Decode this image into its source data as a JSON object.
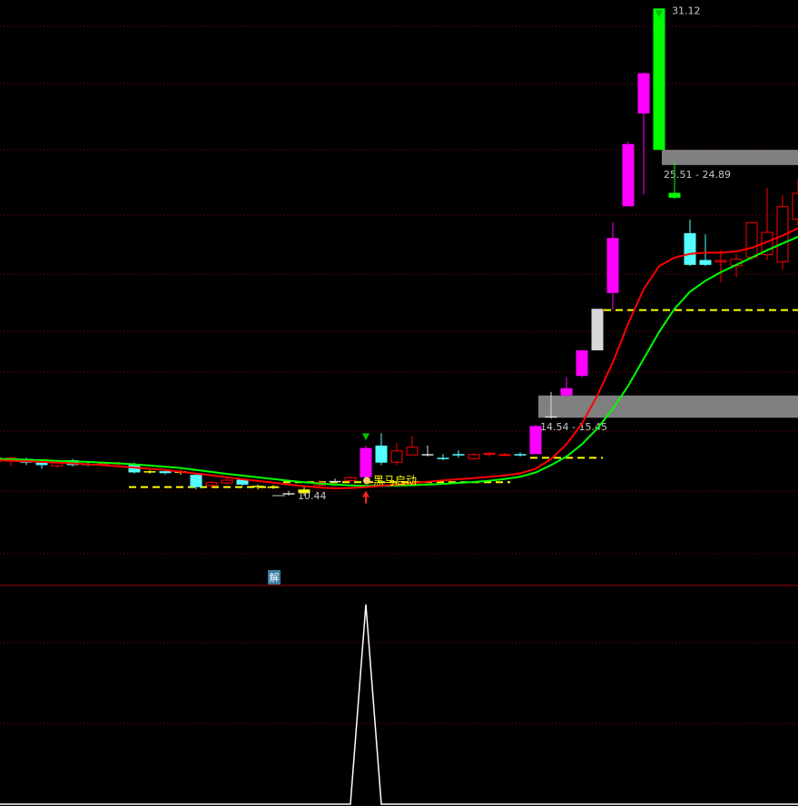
{
  "chart_data": {
    "type": "candlestick",
    "y_unit": "price",
    "ylim": [
      8.6,
      31.5
    ],
    "candles": [
      {
        "o": 12.9,
        "h": 13.0,
        "l": 12.7,
        "c": 12.75,
        "color": "white"
      },
      {
        "o": 12.75,
        "h": 12.95,
        "l": 12.55,
        "c": 12.9,
        "color": "red"
      },
      {
        "o": 12.85,
        "h": 12.9,
        "l": 12.6,
        "c": 12.7,
        "color": "cyan"
      },
      {
        "o": 12.7,
        "h": 12.8,
        "l": 12.45,
        "c": 12.6,
        "color": "cyan"
      },
      {
        "o": 12.55,
        "h": 12.8,
        "l": 12.5,
        "c": 12.75,
        "color": "red"
      },
      {
        "o": 12.8,
        "h": 12.85,
        "l": 12.55,
        "c": 12.6,
        "color": "cyan"
      },
      {
        "o": 12.65,
        "h": 12.72,
        "l": 12.55,
        "c": 12.62,
        "color": "cyan"
      },
      {
        "o": 12.6,
        "h": 12.75,
        "l": 12.55,
        "c": 12.68,
        "color": "red"
      },
      {
        "o": 12.65,
        "h": 12.75,
        "l": 12.5,
        "c": 12.7,
        "color": "red"
      },
      {
        "o": 12.65,
        "h": 12.7,
        "l": 12.25,
        "c": 12.3,
        "color": "cyan"
      },
      {
        "o": 12.35,
        "h": 12.4,
        "l": 12.25,
        "c": 12.3,
        "color": "yellow"
      },
      {
        "o": 12.35,
        "h": 12.42,
        "l": 12.22,
        "c": 12.27,
        "color": "cyan"
      },
      {
        "o": 12.35,
        "h": 12.4,
        "l": 12.2,
        "c": 12.28,
        "color": "yellow"
      },
      {
        "o": 12.2,
        "h": 12.25,
        "l": 11.6,
        "c": 11.7,
        "color": "cyan"
      },
      {
        "o": 11.75,
        "h": 11.95,
        "l": 11.65,
        "c": 11.9,
        "color": "red"
      },
      {
        "o": 11.85,
        "h": 12.1,
        "l": 11.8,
        "c": 12.0,
        "color": "red"
      },
      {
        "o": 12.0,
        "h": 12.05,
        "l": 11.75,
        "c": 11.8,
        "color": "cyan"
      },
      {
        "o": 11.75,
        "h": 11.8,
        "l": 11.6,
        "c": 11.72,
        "color": "yellow"
      },
      {
        "o": 11.72,
        "h": 11.78,
        "l": 11.62,
        "c": 11.72,
        "color": "yellow"
      },
      {
        "o": 11.45,
        "h": 11.55,
        "l": 11.35,
        "c": 11.45,
        "color": "white"
      },
      {
        "o": 11.6,
        "h": 11.7,
        "l": 11.35,
        "c": 11.45,
        "color": "yellow"
      },
      {
        "o": 11.75,
        "h": 12.0,
        "l": 11.7,
        "c": 11.9,
        "color": "red"
      },
      {
        "o": 11.95,
        "h": 12.05,
        "l": 11.9,
        "c": 11.95,
        "color": "white"
      },
      {
        "o": 11.95,
        "h": 12.15,
        "l": 11.9,
        "c": 12.1,
        "color": "red"
      },
      {
        "o": 12.1,
        "h": 13.4,
        "l": 12.1,
        "c": 13.3,
        "color": "magenta"
      },
      {
        "o": 13.4,
        "h": 13.9,
        "l": 12.6,
        "c": 12.7,
        "color": "cyan"
      },
      {
        "o": 12.7,
        "h": 13.5,
        "l": 12.6,
        "c": 13.2,
        "color": "red"
      },
      {
        "o": 13.0,
        "h": 13.8,
        "l": 13.0,
        "c": 13.35,
        "color": "red"
      },
      {
        "o": 13.05,
        "h": 13.4,
        "l": 12.95,
        "c": 13.05,
        "color": "white"
      },
      {
        "o": 12.9,
        "h": 13.05,
        "l": 12.8,
        "c": 12.9,
        "color": "cyan"
      },
      {
        "o": 13.05,
        "h": 13.2,
        "l": 12.9,
        "c": 13.05,
        "color": "cyan"
      },
      {
        "o": 12.85,
        "h": 13.1,
        "l": 12.8,
        "c": 13.05,
        "color": "red"
      },
      {
        "o": 13.05,
        "h": 13.15,
        "l": 12.95,
        "c": 13.1,
        "color": "red"
      },
      {
        "o": 13.05,
        "h": 13.1,
        "l": 13.0,
        "c": 13.05,
        "color": "red"
      },
      {
        "o": 13.05,
        "h": 13.12,
        "l": 12.95,
        "c": 13.05,
        "color": "cyan"
      },
      {
        "o": 13.05,
        "h": 14.25,
        "l": 13.05,
        "c": 14.2,
        "color": "magenta"
      },
      {
        "o": 14.55,
        "h": 15.6,
        "l": 14.5,
        "c": 14.6,
        "color": "white"
      },
      {
        "o": 15.45,
        "h": 16.2,
        "l": 15.4,
        "c": 15.75,
        "color": "magenta"
      },
      {
        "o": 16.25,
        "h": 17.3,
        "l": 16.2,
        "c": 17.3,
        "color": "magenta"
      },
      {
        "o": 17.3,
        "h": 19.0,
        "l": 17.3,
        "c": 19.0,
        "color": "white"
      },
      {
        "o": 19.65,
        "h": 22.55,
        "l": 18.95,
        "c": 21.9,
        "color": "magenta"
      },
      {
        "o": 23.2,
        "h": 25.85,
        "l": 23.2,
        "c": 25.75,
        "color": "magenta"
      },
      {
        "o": 27.0,
        "h": 28.7,
        "l": 23.7,
        "c": 28.65,
        "color": "magenta"
      },
      {
        "o": 31.3,
        "h": 31.3,
        "l": 25.51,
        "c": 25.51,
        "color": "green"
      },
      {
        "o": 23.75,
        "h": 25.0,
        "l": 23.5,
        "c": 23.55,
        "color": "green"
      },
      {
        "o": 22.1,
        "h": 22.65,
        "l": 20.75,
        "c": 20.8,
        "color": "cyan"
      },
      {
        "o": 21.0,
        "h": 22.05,
        "l": 20.75,
        "c": 20.8,
        "color": "cyan"
      },
      {
        "o": 21.0,
        "h": 21.4,
        "l": 20.1,
        "c": 20.9,
        "color": "red"
      },
      {
        "o": 20.75,
        "h": 21.25,
        "l": 20.3,
        "c": 21.05,
        "color": "red"
      },
      {
        "o": 21.1,
        "h": 22.55,
        "l": 21.0,
        "c": 22.55,
        "color": "red"
      },
      {
        "o": 21.2,
        "h": 23.95,
        "l": 21.0,
        "c": 22.15,
        "color": "red"
      },
      {
        "o": 20.9,
        "h": 23.65,
        "l": 20.6,
        "c": 23.2,
        "color": "red"
      },
      {
        "o": 22.65,
        "h": 24.3,
        "l": 22.4,
        "c": 23.75,
        "color": "red"
      },
      {
        "o": 22.9,
        "h": 25.0,
        "l": 22.6,
        "c": 24.75,
        "color": "red"
      }
    ],
    "ma_fast": [
      12.8,
      12.78,
      12.76,
      12.73,
      12.7,
      12.67,
      12.63,
      12.6,
      12.55,
      12.5,
      12.45,
      12.4,
      12.33,
      12.25,
      12.18,
      12.1,
      12.02,
      11.95,
      11.88,
      11.8,
      11.73,
      11.68,
      11.65,
      11.66,
      11.7,
      11.75,
      11.8,
      11.86,
      11.92,
      11.97,
      12.02,
      12.07,
      12.12,
      12.18,
      12.26,
      12.45,
      12.85,
      13.45,
      14.3,
      15.45,
      16.8,
      18.4,
      19.8,
      20.75,
      21.1,
      21.25,
      21.3,
      21.3,
      21.35,
      21.5,
      21.75,
      22.0,
      22.3,
      22.6
    ],
    "ma_slow": [
      12.85,
      12.84,
      12.82,
      12.8,
      12.77,
      12.75,
      12.73,
      12.7,
      12.67,
      12.63,
      12.58,
      12.53,
      12.48,
      12.4,
      12.32,
      12.24,
      12.17,
      12.1,
      12.03,
      11.96,
      11.9,
      11.84,
      11.8,
      11.77,
      11.75,
      11.75,
      11.76,
      11.78,
      11.8,
      11.83,
      11.87,
      11.91,
      11.96,
      12.03,
      12.12,
      12.3,
      12.6,
      12.95,
      13.45,
      14.1,
      14.9,
      15.85,
      16.95,
      18.05,
      19.0,
      19.7,
      20.15,
      20.5,
      20.8,
      21.1,
      21.4,
      21.68,
      21.95,
      22.2
    ],
    "support_levels": [
      {
        "y": 11.7,
        "x_from": 9,
        "x_to": 18
      },
      {
        "y": 11.9,
        "x_from": 19,
        "x_to": 33
      },
      {
        "y": 12.9,
        "x_from": 35,
        "x_to": 39
      },
      {
        "y": 18.95,
        "x_from": 39,
        "x_to": 53
      }
    ],
    "zones": [
      {
        "low": 14.54,
        "high": 15.45,
        "label": "14.54 - 15.45",
        "start": 35
      },
      {
        "low": 24.89,
        "high": 25.51,
        "label": "25.51 - 24.89",
        "start": 43
      }
    ],
    "annotations": {
      "high_label": "31.12",
      "low_label": "10.44",
      "signal_text": "黑马启动",
      "badge": "解"
    },
    "indicator": {
      "type": "line",
      "values": [
        0,
        0,
        0,
        0,
        0,
        0,
        0,
        0,
        0,
        0,
        0,
        0,
        0,
        0,
        0,
        0,
        0,
        0,
        0,
        0,
        0,
        0,
        0,
        0,
        1,
        0,
        0,
        0,
        0,
        0,
        0,
        0,
        0,
        0,
        0,
        0,
        0,
        0,
        0,
        0,
        0,
        0,
        0,
        0,
        0,
        0,
        0,
        0,
        0,
        0,
        0,
        0,
        0,
        0
      ]
    },
    "grid": true,
    "colors": {
      "up": "#ff0000",
      "down": "#54ffff",
      "magenta": "#ff00ff",
      "green": "#00ff00",
      "ma_fast": "#ff0000",
      "ma_slow": "#00ff00",
      "support": "#ffff00",
      "zone": "#808080",
      "grid": "#8b0000"
    }
  }
}
